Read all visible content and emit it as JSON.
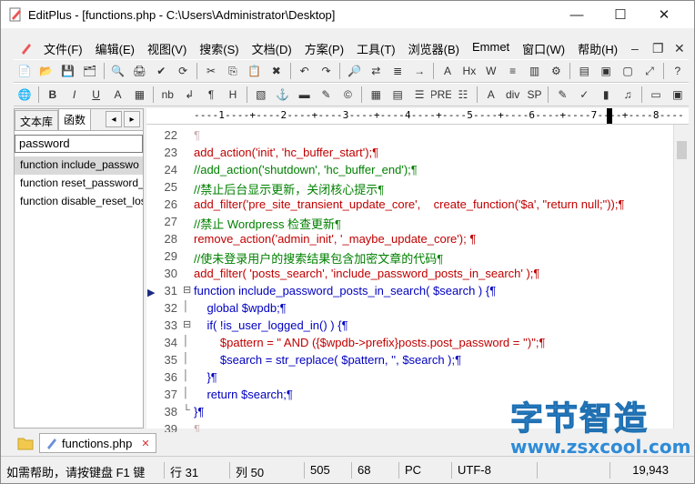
{
  "window": {
    "title": "EditPlus - [functions.php - C:\\Users\\Administrator\\Desktop]",
    "minimize": "—",
    "maximize": "☐",
    "close": "✕",
    "mdi_min": "–",
    "mdi_max": "❐",
    "mdi_close": "✕"
  },
  "menu": [
    "文件(F)",
    "编辑(E)",
    "视图(V)",
    "搜索(S)",
    "文档(D)",
    "方案(P)",
    "工具(T)",
    "浏览器(B)",
    "Emmet",
    "窗口(W)",
    "帮助(H)"
  ],
  "toolbar1": [
    "new-icon",
    "open-icon",
    "save-icon",
    "save-all-icon",
    "print-preview-icon",
    "print-icon",
    "spell-icon",
    "reload-icon",
    "cut-icon",
    "copy-icon",
    "paste-icon",
    "delete-icon",
    "undo-icon",
    "redo-icon",
    "find-icon",
    "replace-icon",
    "find-in-files-icon",
    "goto-icon",
    "font-icon",
    "hex-icon",
    "word-wrap-icon",
    "line-numbers-icon",
    "column-mode-icon",
    "settings-icon",
    "tile-icon",
    "cascade-icon",
    "browser-icon",
    "fullscreen-icon",
    "help-icon"
  ],
  "toolbar2": [
    "browser-globe-icon",
    "B",
    "I",
    "U",
    "A",
    "color-icon",
    "nb",
    "↲",
    "¶",
    "H",
    "image-icon",
    "anchor-icon",
    "hr-icon",
    "marker-icon",
    "©",
    "table-icon",
    "table2-icon",
    "list-icon",
    "PRE",
    "list2-icon",
    "A",
    "div",
    "SP",
    "edit-icon",
    "check-icon",
    "film-icon",
    "music-icon",
    "window-icon",
    "window2-icon"
  ],
  "left_panel": {
    "tabs": [
      "文本库",
      "函数"
    ],
    "arrow_left": "◂",
    "arrow_right": "▸",
    "search_value": "password",
    "items": [
      "function include_passwo",
      "function reset_password_",
      "function disable_reset_los"
    ]
  },
  "ruler": {
    "text": "----1----+----2----+----3----+----4----+----5----+----6----+----7----+----8----"
  },
  "editor": {
    "lines": [
      {
        "n": "22",
        "text": "¶",
        "cls": "pil"
      },
      {
        "n": "23",
        "text": "add_action('init', 'hc_buffer_start');¶",
        "cls": "pl"
      },
      {
        "n": "24",
        "text": "//add_action('shutdown', 'hc_buffer_end');¶",
        "cls": "cm"
      },
      {
        "n": "25",
        "text": "//禁止后台显示更新，关闭核心提示¶",
        "cls": "cm"
      },
      {
        "n": "26",
        "text": "add_filter('pre_site_transient_update_core',    create_function('$a', \"return null;\"));¶",
        "cls": "pl"
      },
      {
        "n": "27",
        "text": "//禁止 Wordpress 检查更新¶",
        "cls": "cm"
      },
      {
        "n": "28",
        "text": "remove_action('admin_init', '_maybe_update_core'); ¶",
        "cls": "pl"
      },
      {
        "n": "29",
        "text": "//使未登录用户的搜索结果包含加密文章的代码¶",
        "cls": "cm"
      },
      {
        "n": "30",
        "text": "add_filter( 'posts_search', 'include_password_posts_in_search' );¶",
        "cls": "pl"
      },
      {
        "n": "31",
        "text": "function include_password_posts_in_search( $search ) {¶",
        "cls": "kw"
      },
      {
        "n": "32",
        "text": "    global $wpdb;¶",
        "cls": "kw"
      },
      {
        "n": "33",
        "text": "    if( !is_user_logged_in() ) {¶",
        "cls": "kw"
      },
      {
        "n": "34",
        "text": "        $pattern = \" AND ({$wpdb->prefix}posts.post_password = '')\";¶",
        "cls": "pl"
      },
      {
        "n": "35",
        "text": "        $search = str_replace( $pattern, '', $search );¶",
        "cls": "kw"
      },
      {
        "n": "36",
        "text": "    }¶",
        "cls": "kw"
      },
      {
        "n": "37",
        "text": "    return $search;¶",
        "cls": "kw"
      },
      {
        "n": "38",
        "text": "}¶",
        "cls": "kw"
      },
      {
        "n": "39",
        "text": "¶",
        "cls": "pil"
      }
    ]
  },
  "file_tab": "functions.php",
  "file_tab_close": "✕",
  "status": [
    "如需帮助，请按键盘 F1 键",
    "行 31",
    "列 50",
    "505",
    "68",
    "PC",
    "UTF-8",
    "",
    "19,943"
  ],
  "watermark": {
    "big": "字节智造",
    "url": "www.zsxcool.com"
  },
  "colors": {
    "keyword": "#0000c0",
    "comment": "#008000",
    "string": "#c00000",
    "brand": "#2f8bd7"
  }
}
